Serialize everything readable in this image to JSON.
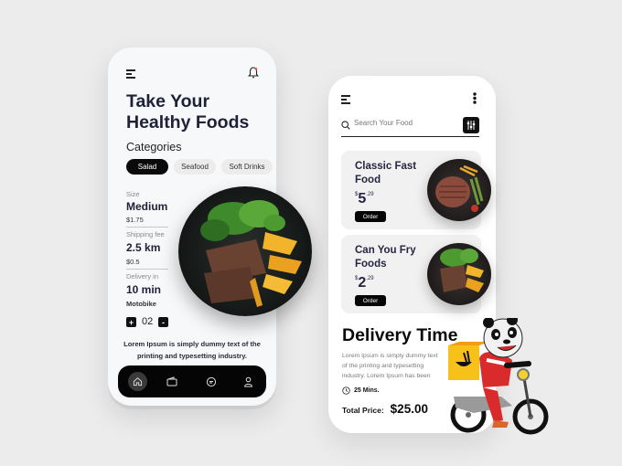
{
  "screen1": {
    "menu_icon": "hamburger-icon",
    "notification_icon": "bell-icon",
    "title_line1": "Take Your",
    "title_line2": "Healthy Foods",
    "categories_label": "Categories",
    "categories": [
      {
        "label": "Salad",
        "active": true
      },
      {
        "label": "Seafood",
        "active": false
      },
      {
        "label": "Soft Drinks",
        "active": false
      }
    ],
    "details": [
      {
        "label": "Size",
        "value": "Medium",
        "sub": "$1.75"
      },
      {
        "label": "Shipping fee",
        "value": "2.5 km",
        "sub": "$0.5"
      },
      {
        "label": "Delivery in",
        "value": "10 min",
        "sub": "Motobike"
      }
    ],
    "quantity": {
      "plus": "+",
      "value": "02",
      "minus": "-"
    },
    "description": "Lorem Ipsum is simply dummy text of the printing and typesetting industry.",
    "nav": [
      {
        "name": "home-icon",
        "active": true
      },
      {
        "name": "wallet-icon",
        "active": false
      },
      {
        "name": "chat-icon",
        "active": false
      },
      {
        "name": "profile-icon",
        "active": false
      }
    ],
    "image": "steak-salad-plate"
  },
  "screen2": {
    "menu_icon": "hamburger-icon",
    "more_icon": "kebab-menu-icon",
    "search": {
      "placeholder": "Search Your Food",
      "icon": "search-icon",
      "filter_icon": "filter-icon"
    },
    "items": [
      {
        "title_line1": "Classic Fast",
        "title_line2": "Food",
        "currency": "$",
        "price_int": "5",
        "price_dec": ".29",
        "order_label": "Order",
        "image": "burger-patty-plate"
      },
      {
        "title_line1": "Can You Fry",
        "title_line2": "Foods",
        "currency": "$",
        "price_int": "2",
        "price_dec": ".29",
        "order_label": "Order",
        "image": "steak-fries-plate"
      }
    ],
    "delivery_title": "Delivery Time",
    "delivery_desc": "Lorem Ipsum is simply dummy text of the printing and typesetting industry. Lorem Ipsum has been",
    "time_label": "25 Mins.",
    "total_label": "Total Price:",
    "total_value": "$25.00",
    "mascot": "panda-delivery-scooter"
  }
}
